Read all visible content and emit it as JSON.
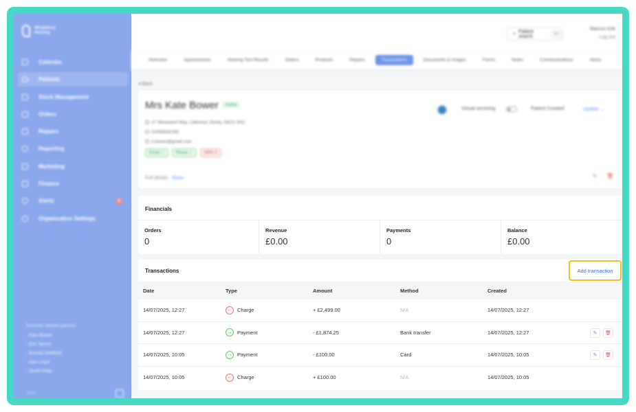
{
  "sidebar": {
    "logo_line1": "Whalebury",
    "logo_line2": "Hearing",
    "items": [
      {
        "label": "Calendar"
      },
      {
        "label": "Patients"
      },
      {
        "label": "Stock Management"
      },
      {
        "label": "Orders"
      },
      {
        "label": "Repairs"
      },
      {
        "label": "Reporting"
      },
      {
        "label": "Marketing"
      },
      {
        "label": "Finance"
      },
      {
        "label": "Alerts",
        "badge": "3"
      },
      {
        "label": "Organisation Settings"
      }
    ],
    "recent_title": "Recently viewed patients",
    "recent": [
      "- Kate Bower",
      "- Eric Tanner",
      "- Brenda Sheffield",
      "- Alan Lloyd",
      "- Geoff Philip"
    ],
    "version": "1.0.0"
  },
  "header": {
    "search_label": "Patient search",
    "search_shortcut": "⌘K",
    "user_name": "Marcus Kirk",
    "logout": "Log out"
  },
  "tabs": [
    "Overview",
    "Appointments",
    "Hearing Test Results",
    "Orders",
    "Products",
    "Repairs",
    "Transactions",
    "Documents & Images",
    "Forms",
    "Notes",
    "Communications",
    "Alerts"
  ],
  "patient": {
    "back": "Back",
    "name": "Mrs Kate Bower",
    "status": "Active",
    "address": "27 Westward Way, Littleover, Derby, DE22 3HC",
    "phone": "01908542166",
    "email": "k.bower@gmail.com",
    "tags": [
      "Email ✓",
      "Phone ✓",
      "SMS ✕"
    ],
    "full_details": "Full details",
    "show": "Show",
    "virtual_servicing": "Virtual servicing",
    "created": "Patient Created",
    "update": "Update ⌄"
  },
  "financials": {
    "title": "Financials",
    "stats": [
      {
        "label": "Orders",
        "value": "0"
      },
      {
        "label": "Revenue",
        "value": "£0.00"
      },
      {
        "label": "Payments",
        "value": "0"
      },
      {
        "label": "Balance",
        "value": "£0.00"
      }
    ]
  },
  "transactions": {
    "title": "Transactions",
    "add_label": "Add transaction",
    "columns": [
      "Date",
      "Type",
      "Amount",
      "Method",
      "Created"
    ],
    "rows": [
      {
        "date": "14/07/2025, 12:27",
        "type": "Charge",
        "amount": "+ £2,499.00",
        "method": "N/A",
        "created": "14/07/2025, 12:27"
      },
      {
        "date": "14/07/2025, 12:27",
        "type": "Payment",
        "amount": "- £1,874.25",
        "method": "Bank transfer",
        "created": "14/07/2025, 12:27"
      },
      {
        "date": "14/07/2025, 10:05",
        "type": "Payment",
        "amount": "- £100.00",
        "method": "Card",
        "created": "14/07/2025, 10:05"
      },
      {
        "date": "14/07/2025, 10:05",
        "type": "Charge",
        "amount": "+ £100.00",
        "method": "N/A",
        "created": "14/07/2025, 10:05"
      }
    ]
  },
  "colors": {
    "frame": "#48d8c6",
    "sidebar": "#8aa8ec",
    "accent": "#3d6fd8",
    "highlight": "#f1c21b",
    "charge": "#e05555",
    "payment": "#35a55a"
  },
  "icons": {
    "charge": "arrow-left-icon",
    "payment": "arrow-right-icon",
    "edit": "pencil-icon",
    "delete": "trash-icon"
  }
}
